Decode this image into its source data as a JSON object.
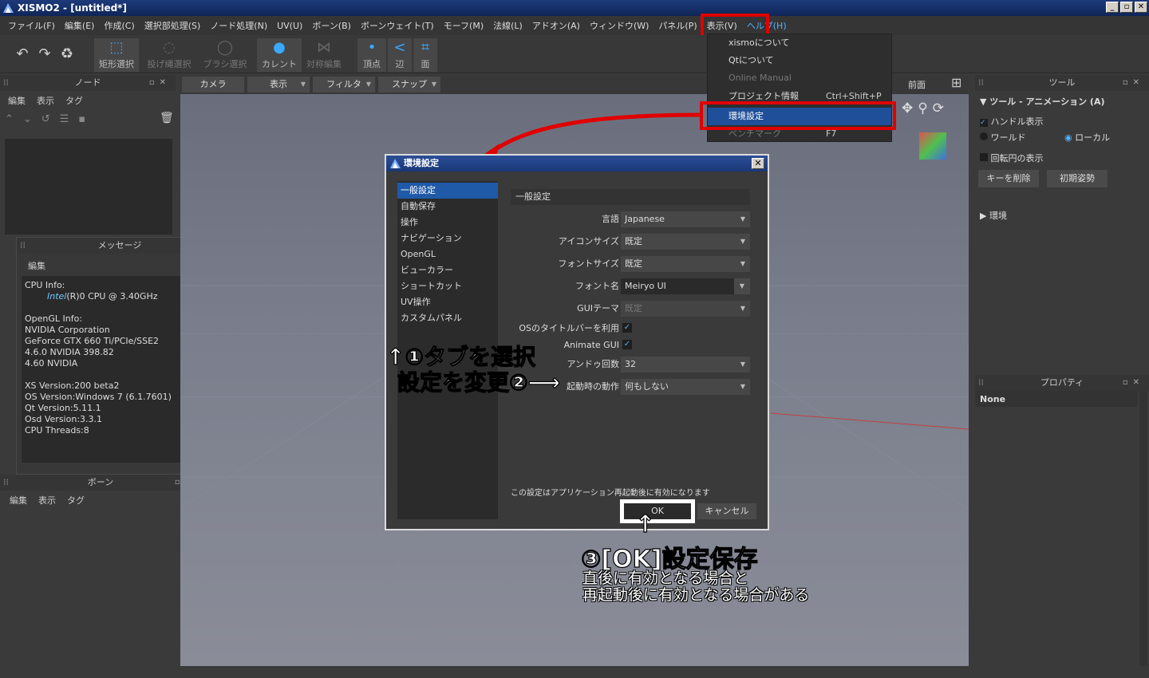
{
  "window": {
    "title": "XISMO2 - [untitled*]",
    "min": "_",
    "max": "▫",
    "close": "✕"
  },
  "menubar": [
    "ファイル(F)",
    "編集(E)",
    "作成(C)",
    "選択部処理(S)",
    "ノード処理(N)",
    "UV(U)",
    "ボーン(B)",
    "ボーンウェイト(T)",
    "モーフ(M)",
    "法線(L)",
    "アドオン(A)",
    "ウィンドウ(W)",
    "パネル(P)",
    "表示(V)",
    "ヘルプ(H)"
  ],
  "toolbar": {
    "undo": "↶",
    "redo": "↷",
    "recycle": "♻",
    "rect_select": "矩形選択",
    "lasso_select": "投げ縄選択",
    "brush_select": "ブラシ選択",
    "current": "カレント",
    "symmetry": "対称編集",
    "vertex": "頂点",
    "edge": "辺",
    "face": "面"
  },
  "node_panel": {
    "title": "ノード",
    "sub": [
      "編集",
      "表示",
      "タグ"
    ]
  },
  "message_panel": {
    "title": "メッセージ",
    "sub": "編集",
    "lines_before": "CPU Info:\n        ",
    "intel": "Intel",
    "lines_after": "(R)0 CPU @ 3.40GHz\n\nOpenGL Info:\nNVIDIA Corporation\nGeForce GTX 660 Ti/PCIe/SSE2\n4.6.0 NVIDIA 398.82\n4.60 NVIDIA\n\nXS Version:200 beta2\nOS Version:Windows 7 (6.1.7601)\nQt Version:5.11.1\nOsd Version:3.3.1\nCPU Threads:8"
  },
  "bone_panel": {
    "title": "ボーン",
    "sub": [
      "編集",
      "表示",
      "タグ"
    ]
  },
  "viewport_tabs": [
    "カメラ",
    "表示",
    "フィルタ",
    "スナップ"
  ],
  "view_label": "前面",
  "help_menu": [
    {
      "label": "xismoについて",
      "shortcut": ""
    },
    {
      "label": "Qtについて",
      "shortcut": ""
    },
    {
      "label": "Online Manual",
      "shortcut": "",
      "disabled": true
    },
    {
      "label": "プロジェクト情報",
      "shortcut": "Ctrl+Shift+P"
    },
    {
      "label": "環境設定",
      "shortcut": "",
      "selected": true
    },
    {
      "label": "ベンチマーク",
      "shortcut": "F7",
      "disabled": true
    }
  ],
  "tool_panel": {
    "title": "ツール",
    "section": "ツール - アニメーション (A)",
    "handle": "ハンドル表示",
    "world": "ワールド",
    "local": "ローカル",
    "rotation_circle": "回転円の表示",
    "delete_key": "キーを削除",
    "initial_pose": "初期姿勢",
    "env": "環境"
  },
  "property_panel": {
    "title": "プロパティ",
    "value": "None"
  },
  "dialog": {
    "title": "環境設定",
    "tabs": [
      "一般設定",
      "自動保存",
      "操作",
      "ナビゲーション",
      "OpenGL",
      "ビューカラー",
      "ショートカット",
      "UV操作",
      "カスタムパネル"
    ],
    "section": "一般設定",
    "fields": [
      {
        "label": "言語",
        "value": "Japanese"
      },
      {
        "label": "アイコンサイズ",
        "value": "既定"
      },
      {
        "label": "フォントサイズ",
        "value": "既定"
      },
      {
        "label": "フォント名",
        "value": "Meiryo UI"
      },
      {
        "label": "GUIテーマ",
        "value": "既定"
      },
      {
        "label": "OSのタイトルバーを利用",
        "value": "✓"
      },
      {
        "label": "Animate GUI",
        "value": "✓"
      },
      {
        "label": "アンドゥ回数",
        "value": "32"
      },
      {
        "label": "起動時の動作",
        "value": "何もしない"
      }
    ],
    "note": "この設定はアプリケーション再起動後に有効になります",
    "ok": "OK",
    "cancel": "キャンセル"
  },
  "annotations": {
    "step1": "↑①タブを選択",
    "step2": "設定を変更②⟶",
    "arrow_up": "↑",
    "step3": "③[OK]設定保存",
    "note1": "直後に有効となる場合と",
    "note2": "再起動後に有効となる場合がある"
  },
  "colors": {
    "highlight": "#e00000",
    "selection": "#1f5aa8",
    "accent": "#39a8ff"
  }
}
